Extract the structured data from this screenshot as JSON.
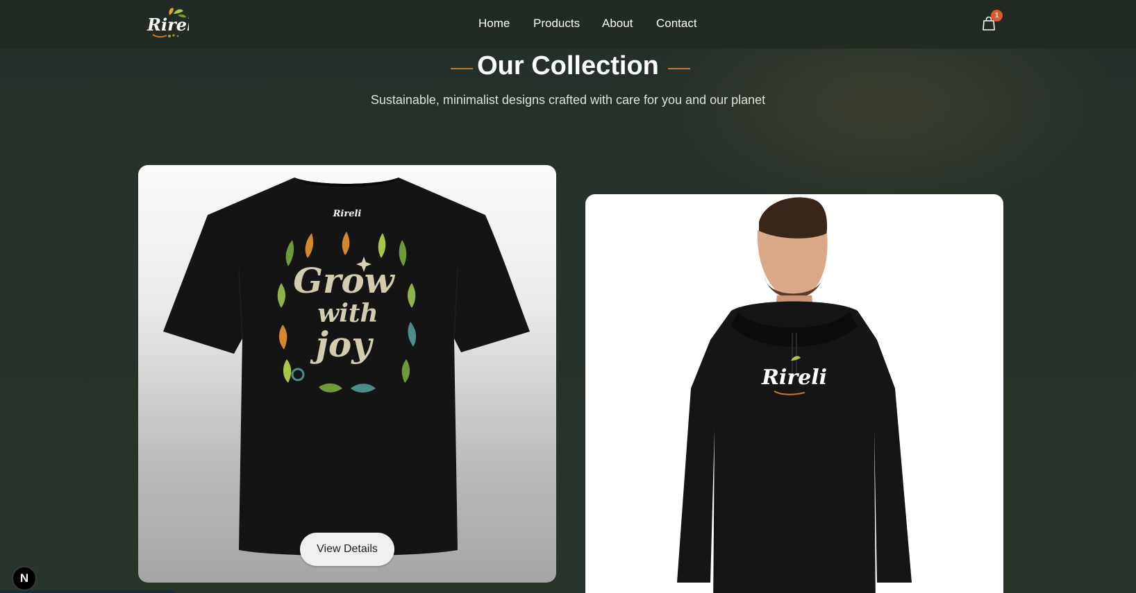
{
  "brand": {
    "logo_text": "Rireli"
  },
  "nav": {
    "items": [
      {
        "label": "Home"
      },
      {
        "label": "Products"
      },
      {
        "label": "About"
      },
      {
        "label": "Contact"
      }
    ]
  },
  "cart": {
    "count": "1",
    "icon": "shopping-bag-icon"
  },
  "collection": {
    "title": "Our Collection",
    "subtitle": "Sustainable, minimalist designs crafted with care for you and our planet"
  },
  "products": [
    {
      "print_brand": "Rireli",
      "print_text_line1": "Grow",
      "print_text_line2": "with",
      "print_text_line3": "joy",
      "button_label": "View Details"
    },
    {
      "print_brand": "Rireli"
    }
  ],
  "dev_badge": {
    "label": "N"
  },
  "colors": {
    "background": "#263127",
    "header": "#212b23",
    "accent": "#c17a3a",
    "badge": "#e4572e"
  }
}
